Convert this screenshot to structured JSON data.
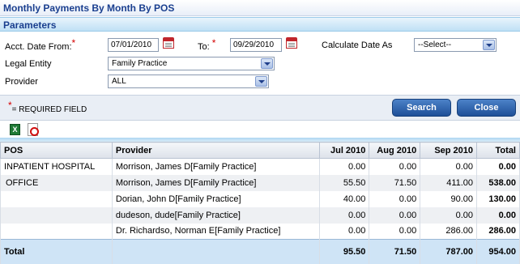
{
  "title": "Monthly Payments By Month By POS",
  "section_title": "Parameters",
  "params": {
    "acct_date_from_label": "Acct. Date From:",
    "acct_date_from_value": "07/01/2010",
    "to_label": "To:",
    "to_value": "09/29/2010",
    "calculate_date_as_label": "Calculate Date As",
    "calculate_date_as_value": "--Select--",
    "legal_entity_label": "Legal Entity",
    "legal_entity_value": "Family Practice",
    "provider_label": "Provider",
    "provider_value": "ALL",
    "required_marker": "*"
  },
  "required_note": "= REQUIRED FIELD",
  "buttons": {
    "search": "Search",
    "close": "Close"
  },
  "icons": {
    "export_excel": "excel-icon",
    "export_pdf": "pdf-icon"
  },
  "table": {
    "columns": [
      "POS",
      "Provider",
      "Jul 2010",
      "Aug 2010",
      "Sep 2010",
      "Total"
    ],
    "rows": [
      {
        "pos": "INPATIENT HOSPITAL",
        "provider": "Morrison, James D[Family Practice]",
        "jul": "0.00",
        "aug": "0.00",
        "sep": "0.00",
        "total": "0.00"
      },
      {
        "pos": "OFFICE",
        "provider": "Morrison, James D[Family Practice]",
        "jul": "55.50",
        "aug": "71.50",
        "sep": "411.00",
        "total": "538.00"
      },
      {
        "pos": "",
        "provider": "Dorian, John D[Family Practice]",
        "jul": "40.00",
        "aug": "0.00",
        "sep": "90.00",
        "total": "130.00"
      },
      {
        "pos": "",
        "provider": "dudeson, dude[Family Practice]",
        "jul": "0.00",
        "aug": "0.00",
        "sep": "0.00",
        "total": "0.00"
      },
      {
        "pos": "",
        "provider": "Dr. Richardso, Norman E[Family Practice]",
        "jul": "0.00",
        "aug": "0.00",
        "sep": "286.00",
        "total": "286.00"
      }
    ],
    "total_row": {
      "label": "Total",
      "jul": "95.50",
      "aug": "71.50",
      "sep": "787.00",
      "total": "954.00"
    }
  },
  "colors": {
    "title_text": "#1a3f8f",
    "button": "#1e4f98",
    "required": "#d40000",
    "total_row": "#cfe4f6"
  }
}
